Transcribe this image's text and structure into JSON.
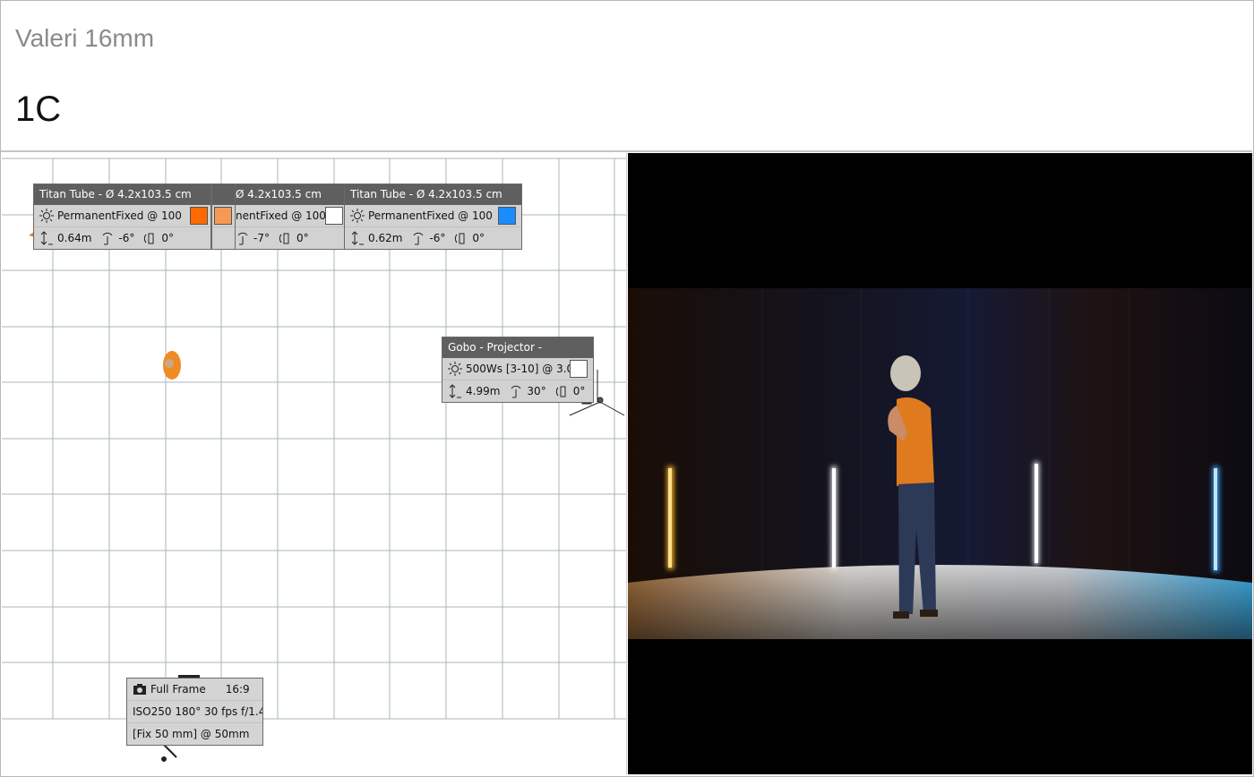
{
  "header": {
    "subtitle": "Valeri 16mm",
    "title": "1C"
  },
  "lights": [
    {
      "name": "Titan Tube - Ø 4.2x103.5 cm",
      "mode": "PermanentFixed @ 100",
      "color": "#ff6a00",
      "height": "0.64m",
      "tilt": "-6°",
      "roll": "0°"
    },
    {
      "name": "Ø 4.2x103.5 cm",
      "mode": "nentFixed @ 100",
      "color": "#ffffff",
      "height": "",
      "tilt": "-7°",
      "roll": "0°"
    },
    {
      "name": "Titan Tube - Ø 4.2x103.5 cm",
      "mode": "PermanentFixed @ 100",
      "color": "#1a8cff",
      "height": "0.62m",
      "tilt": "-6°",
      "roll": "0°"
    }
  ],
  "overlap_swatch_color": "#f59a55",
  "gobo": {
    "name": "Gobo - Projector -",
    "mode": "500Ws [3-10] @ 3.0",
    "color": "#ffffff",
    "height": "4.99m",
    "tilt": "30°",
    "roll": "0°"
  },
  "camera": {
    "sensor": "Full Frame",
    "aspect": "16:9",
    "settings": "ISO250  180°  30 fps  f/1.4",
    "lens": "[Fix 50 mm] @ 50mm"
  },
  "icons": {
    "light": "sun-icon",
    "height": "height-arrow-icon",
    "tilt": "tilt-icon",
    "roll": "roll-icon",
    "camera": "camera-icon"
  }
}
